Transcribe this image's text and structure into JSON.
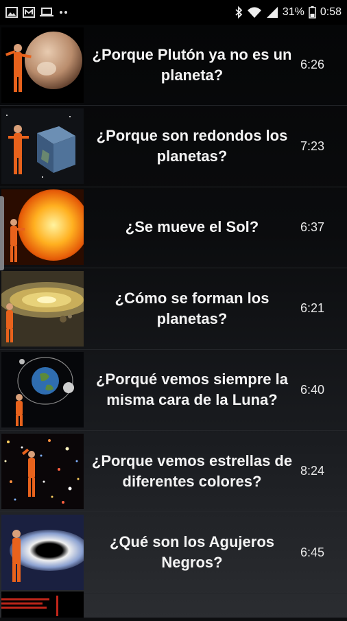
{
  "status_bar": {
    "battery_percent": "31%",
    "time": "0:58",
    "icons": [
      "gallery-icon",
      "message-icon",
      "laptop-icon",
      "more-dots-icon",
      "bluetooth-icon",
      "wifi-icon",
      "signal-icon",
      "battery-icon"
    ]
  },
  "videos": [
    {
      "title": "¿Porque Plutón ya no es un planeta?",
      "duration": "6:26",
      "thumbnail": "pluto-thumbnail"
    },
    {
      "title": "¿Porque son redondos los planetas?",
      "duration": "7:23",
      "thumbnail": "cube-planet-thumbnail"
    },
    {
      "title": "¿Se mueve el Sol?",
      "duration": "6:37",
      "thumbnail": "sun-thumbnail"
    },
    {
      "title": "¿Cómo se forman los planetas?",
      "duration": "6:21",
      "thumbnail": "protoplanetary-disk-thumbnail"
    },
    {
      "title": "¿Porqué vemos siempre la misma cara de la Luna?",
      "duration": "6:40",
      "thumbnail": "earth-moon-orbit-thumbnail"
    },
    {
      "title": "¿Porque vemos estrellas de diferentes colores?",
      "duration": "8:24",
      "thumbnail": "star-field-thumbnail"
    },
    {
      "title": "¿Qué son los Agujeros Negros?",
      "duration": "6:45",
      "thumbnail": "black-hole-thumbnail"
    }
  ],
  "colors": {
    "background": "#0d0e10",
    "status_bar": "#000000",
    "text": "#f4f4f4",
    "astronaut_suit": "#e8621c"
  }
}
